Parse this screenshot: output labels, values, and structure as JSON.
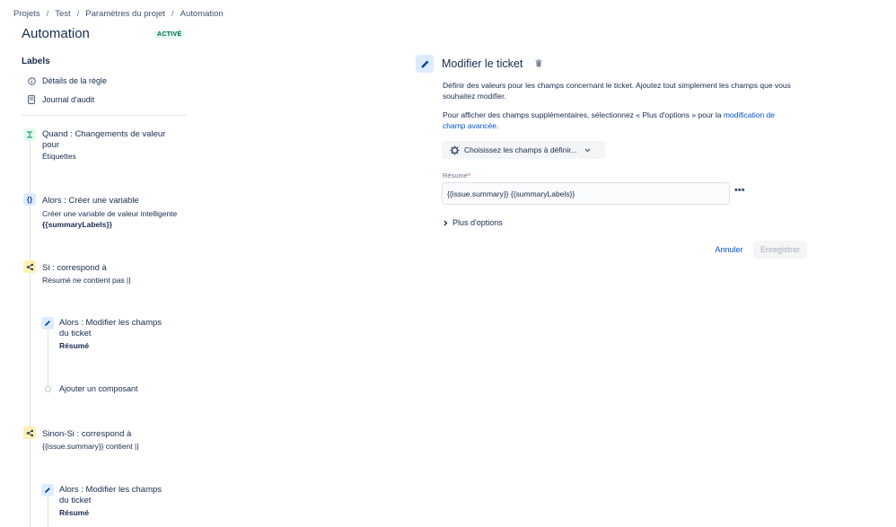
{
  "breadcrumb": [
    "Projets",
    "Test",
    "Paramètres du projet",
    "Automation"
  ],
  "page_title": "Automation",
  "status_badge": "ACTIVÉ",
  "sidebar": {
    "labels_heading": "Labels",
    "rule_details": "Détails de la règle",
    "audit_log": "Journal d'audit"
  },
  "components": {
    "trigger": {
      "title_line1": "Quand : Changements de valeur",
      "title_line2": "pour",
      "sub": "Étiquettes"
    },
    "create_var": {
      "title": "Alors : Créer une variable",
      "sub": "Créer une variable de valeur intelligente",
      "bold": "{{summaryLabels}}"
    },
    "condition1": {
      "title": "Si : correspond à",
      "sub": "Résumé ne contient pas ||"
    },
    "edit1": {
      "title_line1": "Alors : Modifier les champs",
      "title_line2": "du ticket",
      "bold": "Résumé"
    },
    "add_component": "Ajouter un composant",
    "condition2": {
      "title": "Sinon-Si : correspond à",
      "sub": "{{issue.summary}} contient ||"
    },
    "edit2": {
      "title_line1": "Alors : Modifier les champs",
      "title_line2": "du ticket",
      "bold": "Résumé"
    }
  },
  "panel": {
    "title": "Modifier le ticket",
    "desc1_line1": "Définir des valeurs pour les champs concernant le ticket. Ajoutez tout simplement les champs que vous",
    "desc1_line2": "souhaitez modifier.",
    "desc2_prefix": "Pour afficher des champs supplémentaires, sélectionnez « Plus d'options » pour la ",
    "desc2_link_part1": "modification de",
    "desc2_link_part2": "champ avancée",
    "desc2_suffix": ".",
    "choose_fields": "Choisissez les champs à définir...",
    "field_label": "Résumé",
    "field_required": "*",
    "summary_value": "{{issue.summary}} {{summaryLabels}}",
    "more_dots": "•••",
    "more_options": "Plus d'options",
    "cancel": "Annuler",
    "save": "Enregistrer"
  },
  "colors": {
    "accent": "#0052cc",
    "active_badge_bg": "#e3fcef",
    "active_badge_text": "#006644"
  }
}
